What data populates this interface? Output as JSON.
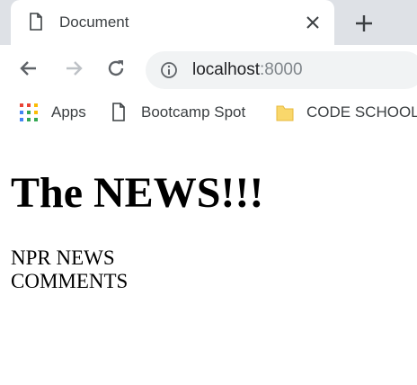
{
  "tab": {
    "title": "Document"
  },
  "omnibox": {
    "host": "localhost",
    "port": ":8000"
  },
  "bookmarks": [
    {
      "label": "Apps",
      "icon": "apps-grid-icon"
    },
    {
      "label": "Bootcamp Spot",
      "icon": "page-icon"
    },
    {
      "label": "CODE SCHOOL",
      "icon": "folder-icon"
    }
  ],
  "page": {
    "headline": "The NEWS!!!",
    "lines": [
      "NPR NEWS",
      "COMMENTS"
    ]
  },
  "colors": {
    "tabstrip": "#dee1e6",
    "omnibox": "#f1f3f4",
    "folder": "#f9d76b"
  }
}
